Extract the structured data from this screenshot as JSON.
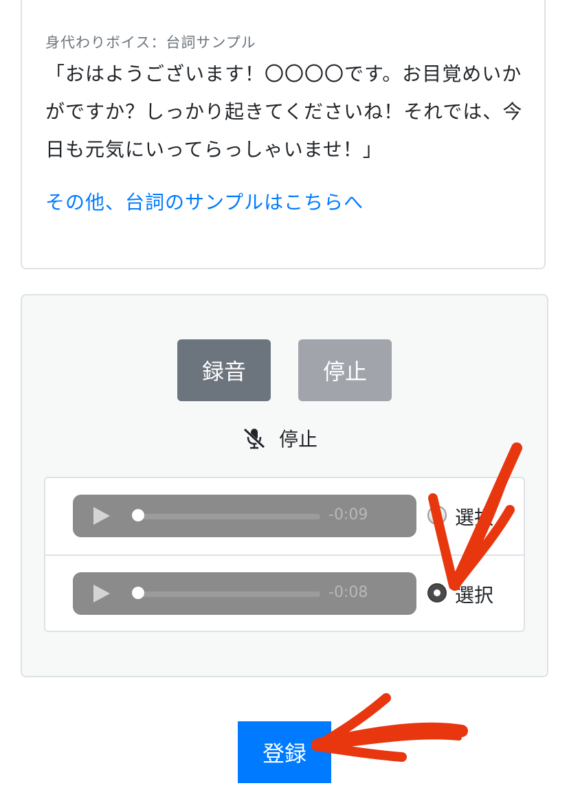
{
  "sample": {
    "caption": "身代わりボイス：台詞サンプル",
    "text": "「おはようございます！〇〇〇〇です。お目覚めいかがですか？しっかり起きてくださいね！それでは、今日も元気にいってらっしゃいませ！」",
    "link": "その他、台詞のサンプルはこちらへ"
  },
  "recorder": {
    "record_label": "録音",
    "stop_label": "停止",
    "status_text": "停止",
    "status_icon": "microphone-slash-icon"
  },
  "recordings": [
    {
      "time": "-0:09",
      "select_label": "選択",
      "selected": false
    },
    {
      "time": "-0:08",
      "select_label": "選択",
      "selected": true
    }
  ],
  "submit_label": "登録",
  "colors": {
    "primary": "#007bff",
    "secondary": "#6c757d",
    "annotation": "#e8360f"
  }
}
